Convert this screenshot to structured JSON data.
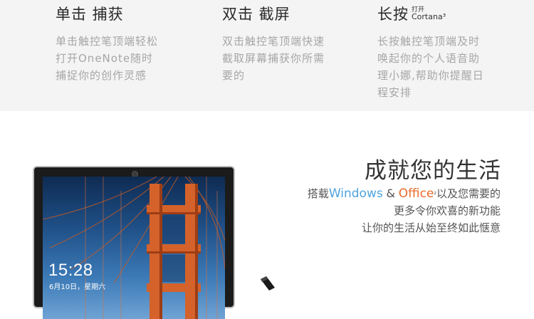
{
  "features": [
    {
      "title": "单击 捕获",
      "sup": "",
      "desc": "单击触控笔顶端轻松打开OneNote随时捕捉你的创作灵感"
    },
    {
      "title": "双击 截屏",
      "sup": "",
      "desc": "双击触控笔顶端快速截取屏幕捕获你所需要的"
    },
    {
      "title": "长按",
      "sup": "打开 Cortana³",
      "desc": "长按触控笔顶端及时唤起你的个人语音助理小娜,帮助你提醒日程安排"
    }
  ],
  "hero": {
    "title": "成就您的生活",
    "line1_pre": "搭载",
    "windows": "Windows",
    "amp": "&",
    "office": "Office",
    "office_sup": "²",
    "line1_post": "以及您需要的",
    "line2": "更多令你欢喜的新功能",
    "line3": "让你的生活从始至终如此惬意"
  },
  "lockscreen": {
    "time": "15:28",
    "date": "6月10日，星期六"
  },
  "colors": {
    "windows": "#4fa3e0",
    "office": "#eb6a2a",
    "band": "#f4f4f4"
  }
}
